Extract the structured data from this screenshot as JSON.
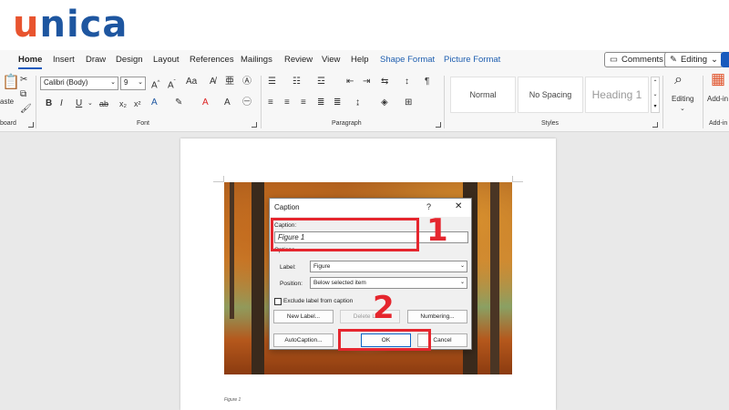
{
  "brand": {
    "logo_first": "u",
    "logo_rest": "nica"
  },
  "menu": {
    "tabs": [
      "Home",
      "Insert",
      "Draw",
      "Design",
      "Layout",
      "References",
      "Mailings",
      "Review",
      "View",
      "Help",
      "Shape Format",
      "Picture Format"
    ],
    "comments_label": "Comments",
    "editing_label": "Editing"
  },
  "ribbon": {
    "clipboard": {
      "paste_label": "aste",
      "group_label": "board"
    },
    "font": {
      "name": "Calibri (Body)",
      "size": "9",
      "group_label": "Font"
    },
    "paragraph": {
      "group_label": "Paragraph"
    },
    "styles": {
      "items": [
        "Normal",
        "No Spacing",
        "Heading 1"
      ],
      "group_label": "Styles"
    },
    "editing": {
      "label": "Editing"
    },
    "addins": {
      "label": "Add-in",
      "group_label": "Add-in"
    }
  },
  "document": {
    "caption_text": "Figure 1"
  },
  "dialog": {
    "title": "Caption",
    "help": "?",
    "close": "✕",
    "caption_label": "Caption:",
    "caption_value": "Figure 1",
    "options_label": "Options",
    "label_label": "Label:",
    "label_value": "Figure",
    "position_label": "Position:",
    "position_value": "Below selected item",
    "exclude_label": "Exclude label from caption",
    "new_label_button": "New Label...",
    "delete_label_button": "Delete Label",
    "numbering_button": "Numbering...",
    "autocaption_button": "AutoCaption...",
    "ok_button": "OK",
    "cancel_button": "Cancel"
  },
  "annotations": {
    "step1": "1",
    "step2": "2",
    "color": "#e5262e"
  },
  "colors": {
    "accent": "#185abd",
    "brand_orange": "#e8542f",
    "brand_blue": "#1e56a0"
  }
}
